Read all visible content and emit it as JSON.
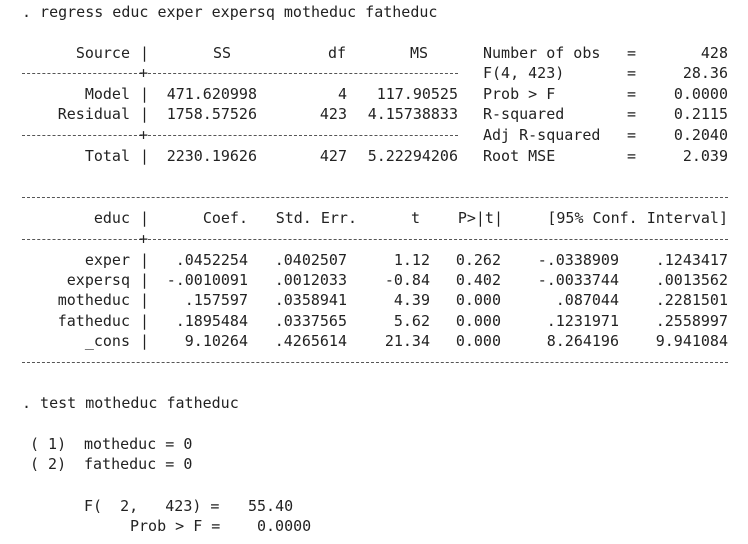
{
  "commands": {
    "regress": ". regress educ exper expersq motheduc fatheduc",
    "test": ". test motheduc fatheduc"
  },
  "anova": {
    "headers": {
      "source": "Source",
      "ss": "SS",
      "df": "df",
      "ms": "MS"
    },
    "rows": [
      {
        "source": "Model",
        "ss": "471.620998",
        "df": "4",
        "ms": "117.90525"
      },
      {
        "source": "Residual",
        "ss": "1758.57526",
        "df": "423",
        "ms": "4.15738833"
      },
      {
        "source": "Total",
        "ss": "2230.19626",
        "df": "427",
        "ms": "5.22294206"
      }
    ]
  },
  "stats": [
    {
      "label": "Number of obs",
      "eq": "=",
      "value": "428"
    },
    {
      "label": "F(4, 423)",
      "eq": "=",
      "value": "28.36"
    },
    {
      "label": "Prob > F",
      "eq": "=",
      "value": "0.0000"
    },
    {
      "label": "R-squared",
      "eq": "=",
      "value": "0.2115"
    },
    {
      "label": "Adj R-squared",
      "eq": "=",
      "value": "0.2040"
    },
    {
      "label": "Root MSE",
      "eq": "=",
      "value": "2.039"
    }
  ],
  "coef": {
    "headers": {
      "var": "educ",
      "coef": "Coef.",
      "se": "Std. Err.",
      "t": "t",
      "p": "P>|t|",
      "ci": "[95% Conf. Interval]"
    },
    "rows": [
      {
        "var": "exper",
        "coef": ".0452254",
        "se": ".0402507",
        "t": "1.12",
        "p": "0.262",
        "lo": "-.0338909",
        "hi": ".1243417"
      },
      {
        "var": "expersq",
        "coef": "-.0010091",
        "se": ".0012033",
        "t": "-0.84",
        "p": "0.402",
        "lo": "-.0033744",
        "hi": ".0013562"
      },
      {
        "var": "motheduc",
        "coef": ".157597",
        "se": ".0358941",
        "t": "4.39",
        "p": "0.000",
        "lo": ".087044",
        "hi": ".2281501"
      },
      {
        "var": "fatheduc",
        "coef": ".1895484",
        "se": ".0337565",
        "t": "5.62",
        "p": "0.000",
        "lo": ".1231971",
        "hi": ".2558997"
      },
      {
        "var": "_cons",
        "coef": "9.10264",
        "se": ".4265614",
        "t": "21.34",
        "p": "0.000",
        "lo": "8.264196",
        "hi": "9.941084"
      }
    ]
  },
  "test": {
    "constraints": [
      {
        "num": "( 1)",
        "expr": "motheduc = 0"
      },
      {
        "num": "( 2)",
        "expr": "fatheduc = 0"
      }
    ],
    "f_label": "F(  2,   423) =",
    "f_value": "55.40",
    "prob_label": "Prob > F =",
    "prob_value": "0.0000"
  }
}
